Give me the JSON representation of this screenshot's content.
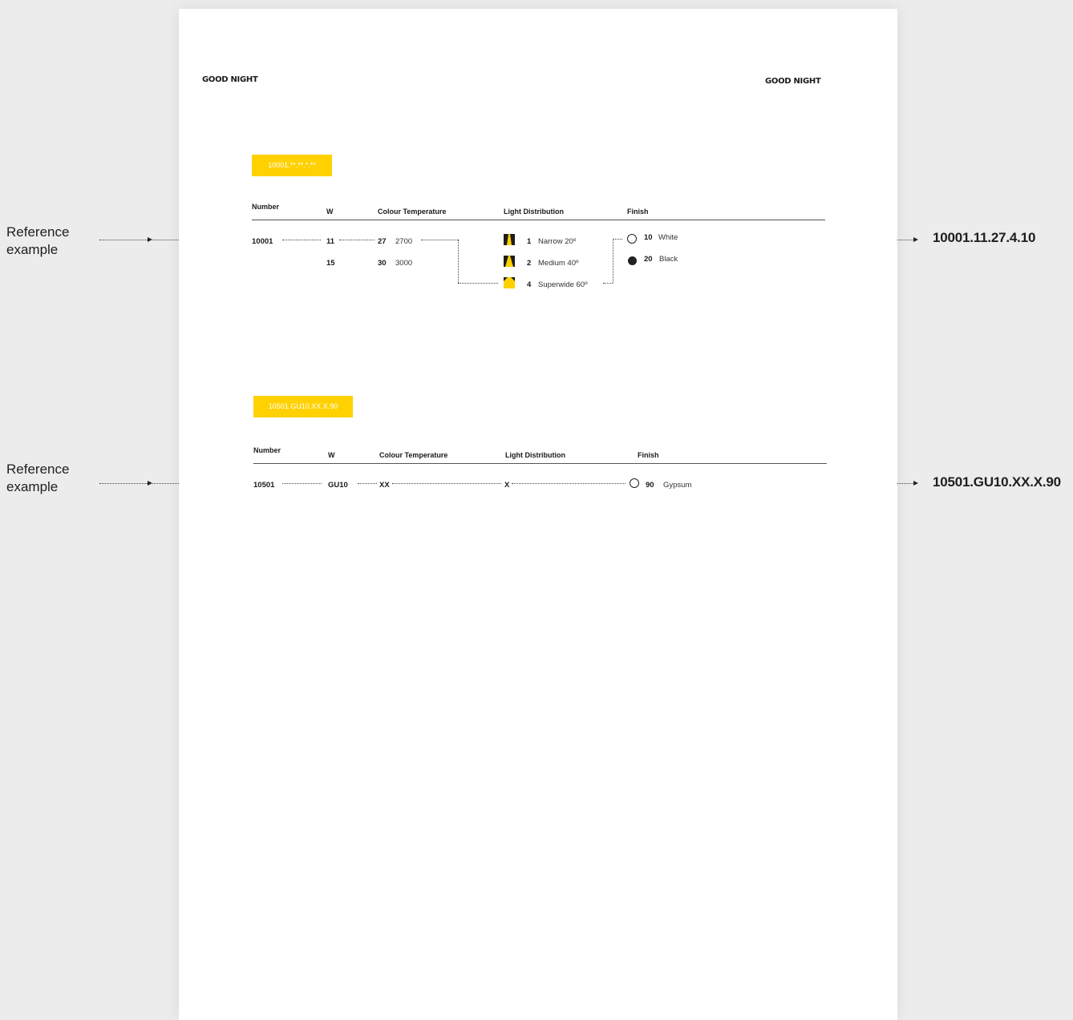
{
  "brand_left": "GOOD NIGHT",
  "brand_right": "GOOD NIGHT",
  "colors": {
    "accent": "#ffd100",
    "ink": "#1e1e1e",
    "page": "#ffffff",
    "background": "#ececec"
  },
  "headers": {
    "number": "Number",
    "w": "W",
    "colour_temperature": "Colour Temperature",
    "light_distribution": "Light Distribution",
    "finish": "Finish"
  },
  "reference": {
    "line1": "Reference",
    "line2": "example"
  },
  "table1": {
    "code": "10001.**.**.*.**",
    "number": "10001",
    "watts": [
      "11",
      "15"
    ],
    "temperatures": [
      {
        "code": "27",
        "value": "2700"
      },
      {
        "code": "30",
        "value": "3000"
      }
    ],
    "distributions": [
      {
        "code": "1",
        "label": "Narrow 20º",
        "icon": "narrow-beam-icon"
      },
      {
        "code": "2",
        "label": "Medium 40º",
        "icon": "medium-beam-icon"
      },
      {
        "code": "4",
        "label": "Superwide 60º",
        "icon": "superwide-beam-icon"
      }
    ],
    "finishes": [
      {
        "code": "10",
        "label": "White",
        "icon": "open-circle-icon"
      },
      {
        "code": "20",
        "label": "Black",
        "icon": "filled-circle-icon"
      }
    ],
    "result": "10001.11.27.4.10"
  },
  "table2": {
    "code": "10501.GU10.XX.X.90",
    "number": "10501",
    "watt": "GU10",
    "temperature": "XX",
    "distribution": "X",
    "finish": {
      "code": "90",
      "label": "Gypsum",
      "icon": "open-circle-icon"
    },
    "result": "10501.GU10.XX.X.90"
  }
}
